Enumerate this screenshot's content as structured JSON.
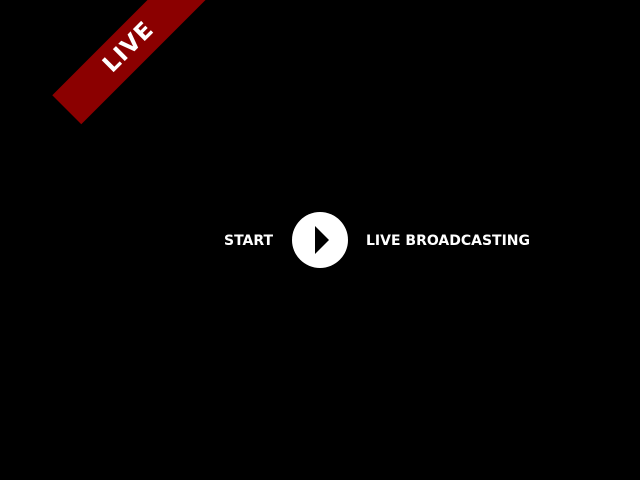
{
  "badge": {
    "text": "LIVE",
    "color": "#8b0000"
  },
  "controls": {
    "start_label": "START",
    "play_icon": "play-icon",
    "broadcast_label": "LIVE BROADCASTING"
  },
  "colors": {
    "background": "#000000",
    "text": "#ffffff",
    "play_button": "#ffffff"
  }
}
